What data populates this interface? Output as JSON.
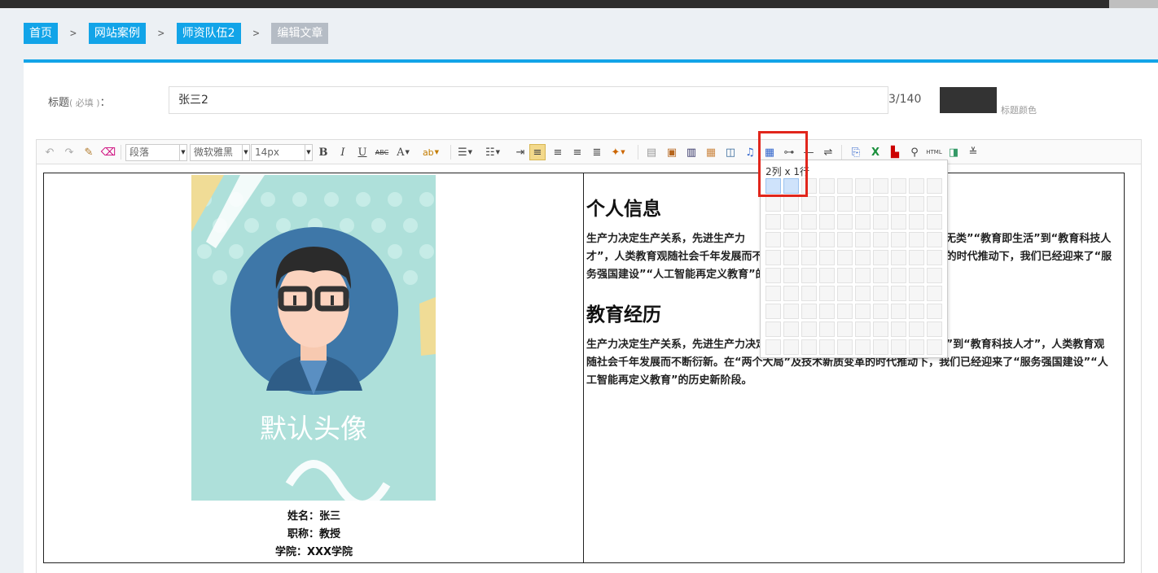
{
  "breadcrumb": {
    "items": [
      "首页",
      "网站案例",
      "师资队伍2"
    ],
    "current": "编辑文章",
    "separator": ">"
  },
  "form": {
    "title_label": "标题",
    "title_required": "( 必填 )",
    "title_colon": "：",
    "title_value": "张三2",
    "counter": "3/140",
    "color_label": "标题颜色",
    "title_color": "#333333"
  },
  "toolbar": {
    "paragraph": "段落",
    "font_family": "微软雅黑",
    "font_size": "14px",
    "bold": "B",
    "italic": "I",
    "underline": "U",
    "strike": "ABC",
    "font_color": "A",
    "html": "HTML"
  },
  "table_picker": {
    "label": "2列 x 1行",
    "columns": 10,
    "rows": 10,
    "selected_cols": 2,
    "selected_rows": 1
  },
  "profile": {
    "avatar_caption": "默认头像",
    "name": "姓名：张三",
    "title": "职称：教授",
    "college": "学院：XXX学院"
  },
  "article": {
    "heading1": "个人信息",
    "para1": "生产力决定生产关系，先进生产力",
    "para1_tail": "有教无类”“教育即生活”到“教育科技人才”，人类教育观随社会千年发展而不断衍新。在“两个大局”及技术新质变革的时代推动下，我们已经迎来了“服务强国建设”“人工智能再定义教育”的历史新阶段。",
    "heading2": "教育经历",
    "para2": "生产力决定生产关系，先进生产力决定教育观念，从“有教无类”“教育即生活”到“教育科技人才”，人类教育观随社会千年发展而不断衍新。在“两个大局”及技术新质变革的时代推动下，我们已经迎来了“服务强国建设”“人工智能再定义教育”的历史新阶段。"
  },
  "colors": {
    "accent": "#12a4e8",
    "highlight": "#e1261c",
    "avatar_bg": "#aee0da"
  }
}
